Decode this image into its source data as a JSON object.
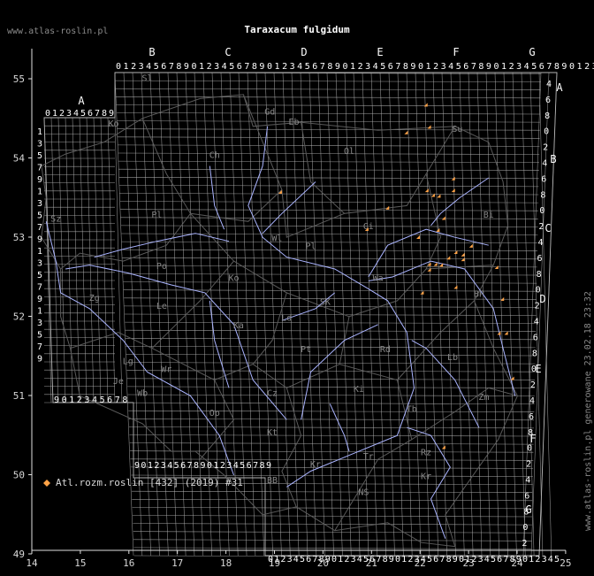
{
  "title": "Taraxacum fulgidum",
  "site": "www.atlas-roslin.pl",
  "side_note": "www.atlas-roslin.pl generowane 23.02.18 23:32",
  "legend": {
    "label": "Atl.rozm.roslin [432] (2019) #31",
    "color": "#ffa347"
  },
  "colors": {
    "background": "#000000",
    "grid": "#b4b4b4",
    "border": "#5a5a5a",
    "river": "#aab4ff",
    "point": "#ffa347"
  },
  "axes": {
    "x_ticks": [
      "14",
      "15",
      "16",
      "17",
      "18",
      "19",
      "20",
      "21",
      "22",
      "23",
      "24",
      "25"
    ],
    "y_ticks": [
      "55",
      "54",
      "53",
      "52",
      "51",
      "50",
      "49"
    ],
    "x_range": [
      14,
      25
    ],
    "y_range": [
      49,
      55.7
    ]
  },
  "grid_columns": {
    "top_letters": [
      "B",
      "C",
      "D",
      "E",
      "F",
      "G"
    ],
    "top_digits": "0123456789012345678901234567890123456789012345678901234567890123456789",
    "left_letter": "A",
    "left_digits": "0123456789",
    "bottom_left_digits": "9012345678901234567890123456789",
    "bottom_digits": "0123456789012345678901234567890123456789012345"
  },
  "grid_rows": {
    "left_digits": [
      "1",
      "3",
      "5",
      "7",
      "9",
      "1",
      "3",
      "5",
      "7",
      "9",
      "1",
      "3",
      "5",
      "7",
      "9",
      "1",
      "3",
      "5",
      "7",
      "9"
    ],
    "right_letters": [
      "A",
      "B",
      "C",
      "D",
      "E",
      "F",
      "G"
    ],
    "right_digits": [
      "4",
      "6",
      "8",
      "0",
      "2",
      "4",
      "6",
      "8",
      "0",
      "2",
      "4",
      "6",
      "8",
      "0",
      "2",
      "4",
      "6",
      "8",
      "0",
      "2",
      "4",
      "6",
      "8",
      "0",
      "2",
      "4",
      "6",
      "8",
      "0",
      "2"
    ]
  },
  "regions": [
    {
      "code": "Sl",
      "lon": 16.4,
      "lat": 54.97
    },
    {
      "code": "Gd",
      "lon": 18.95,
      "lat": 54.55
    },
    {
      "code": "Eb",
      "lon": 19.45,
      "lat": 54.42
    },
    {
      "code": "Su",
      "lon": 22.85,
      "lat": 54.33
    },
    {
      "code": "Ko",
      "lon": 15.7,
      "lat": 54.4
    },
    {
      "code": "Ch",
      "lon": 17.8,
      "lat": 54.0
    },
    {
      "code": "Ol",
      "lon": 20.6,
      "lat": 54.05
    },
    {
      "code": "Pl",
      "lon": 16.6,
      "lat": 53.25
    },
    {
      "code": "Bi",
      "lon": 23.5,
      "lat": 53.25
    },
    {
      "code": "Ci",
      "lon": 21.0,
      "lat": 53.1
    },
    {
      "code": "Sz",
      "lon": 14.5,
      "lat": 53.2
    },
    {
      "code": "Wl",
      "lon": 19.1,
      "lat": 52.95
    },
    {
      "code": "Pl",
      "lon": 19.8,
      "lat": 52.85
    },
    {
      "code": "Po",
      "lon": 16.7,
      "lat": 52.6
    },
    {
      "code": "Ko",
      "lon": 18.2,
      "lat": 52.45
    },
    {
      "code": "Wa",
      "lon": 21.2,
      "lat": 52.45
    },
    {
      "code": "SK",
      "lon": 20.1,
      "lat": 52.15
    },
    {
      "code": "BP",
      "lon": 23.3,
      "lat": 52.25
    },
    {
      "code": "Zg",
      "lon": 15.3,
      "lat": 52.2
    },
    {
      "code": "Le",
      "lon": 16.7,
      "lat": 52.1
    },
    {
      "code": "Ld",
      "lon": 19.3,
      "lat": 51.95
    },
    {
      "code": "Ka",
      "lon": 18.3,
      "lat": 51.85
    },
    {
      "code": "Pt",
      "lon": 19.7,
      "lat": 51.55
    },
    {
      "code": "Rd",
      "lon": 21.35,
      "lat": 51.55
    },
    {
      "code": "Lb",
      "lon": 22.75,
      "lat": 51.45
    },
    {
      "code": "Lg",
      "lon": 16.0,
      "lat": 51.4
    },
    {
      "code": "Wr",
      "lon": 16.8,
      "lat": 51.3
    },
    {
      "code": "Je",
      "lon": 15.8,
      "lat": 51.15
    },
    {
      "code": "Wb",
      "lon": 16.3,
      "lat": 51.0
    },
    {
      "code": "Cz",
      "lon": 19.0,
      "lat": 51.0
    },
    {
      "code": "Ki",
      "lon": 20.8,
      "lat": 51.05
    },
    {
      "code": "Zm",
      "lon": 23.4,
      "lat": 50.95
    },
    {
      "code": "Tb",
      "lon": 21.9,
      "lat": 50.8
    },
    {
      "code": "Op",
      "lon": 17.8,
      "lat": 50.75
    },
    {
      "code": "Kt",
      "lon": 19.0,
      "lat": 50.5
    },
    {
      "code": "Tr",
      "lon": 21.0,
      "lat": 50.2
    },
    {
      "code": "Rz",
      "lon": 22.2,
      "lat": 50.25
    },
    {
      "code": "Kr",
      "lon": 19.9,
      "lat": 50.1
    },
    {
      "code": "Kr",
      "lon": 22.2,
      "lat": 49.95
    },
    {
      "code": "BB",
      "lon": 19.0,
      "lat": 49.9
    },
    {
      "code": "NS",
      "lon": 20.9,
      "lat": 49.75
    }
  ],
  "occurrences": [
    {
      "lon": 22.23,
      "lat": 54.65
    },
    {
      "lon": 21.82,
      "lat": 54.3
    },
    {
      "lon": 22.3,
      "lat": 54.37
    },
    {
      "lon": 19.2,
      "lat": 53.55
    },
    {
      "lon": 22.25,
      "lat": 53.57
    },
    {
      "lon": 22.38,
      "lat": 53.51
    },
    {
      "lon": 22.5,
      "lat": 53.5
    },
    {
      "lon": 22.8,
      "lat": 53.57
    },
    {
      "lon": 22.8,
      "lat": 53.72
    },
    {
      "lon": 21.43,
      "lat": 53.35
    },
    {
      "lon": 22.6,
      "lat": 53.22
    },
    {
      "lon": 21.0,
      "lat": 53.08
    },
    {
      "lon": 22.48,
      "lat": 53.07
    },
    {
      "lon": 22.07,
      "lat": 52.98
    },
    {
      "lon": 23.17,
      "lat": 52.87
    },
    {
      "lon": 22.85,
      "lat": 52.79
    },
    {
      "lon": 23.0,
      "lat": 52.76
    },
    {
      "lon": 23.0,
      "lat": 52.7
    },
    {
      "lon": 22.7,
      "lat": 52.72
    },
    {
      "lon": 22.3,
      "lat": 52.64
    },
    {
      "lon": 22.43,
      "lat": 52.64
    },
    {
      "lon": 22.55,
      "lat": 52.63
    },
    {
      "lon": 22.3,
      "lat": 52.57
    },
    {
      "lon": 23.7,
      "lat": 52.6
    },
    {
      "lon": 22.85,
      "lat": 52.35
    },
    {
      "lon": 22.15,
      "lat": 52.28
    },
    {
      "lon": 23.82,
      "lat": 52.2
    },
    {
      "lon": 23.75,
      "lat": 51.77
    },
    {
      "lon": 23.9,
      "lat": 51.77
    },
    {
      "lon": 24.03,
      "lat": 51.2
    },
    {
      "lon": 22.6,
      "lat": 50.33
    }
  ]
}
